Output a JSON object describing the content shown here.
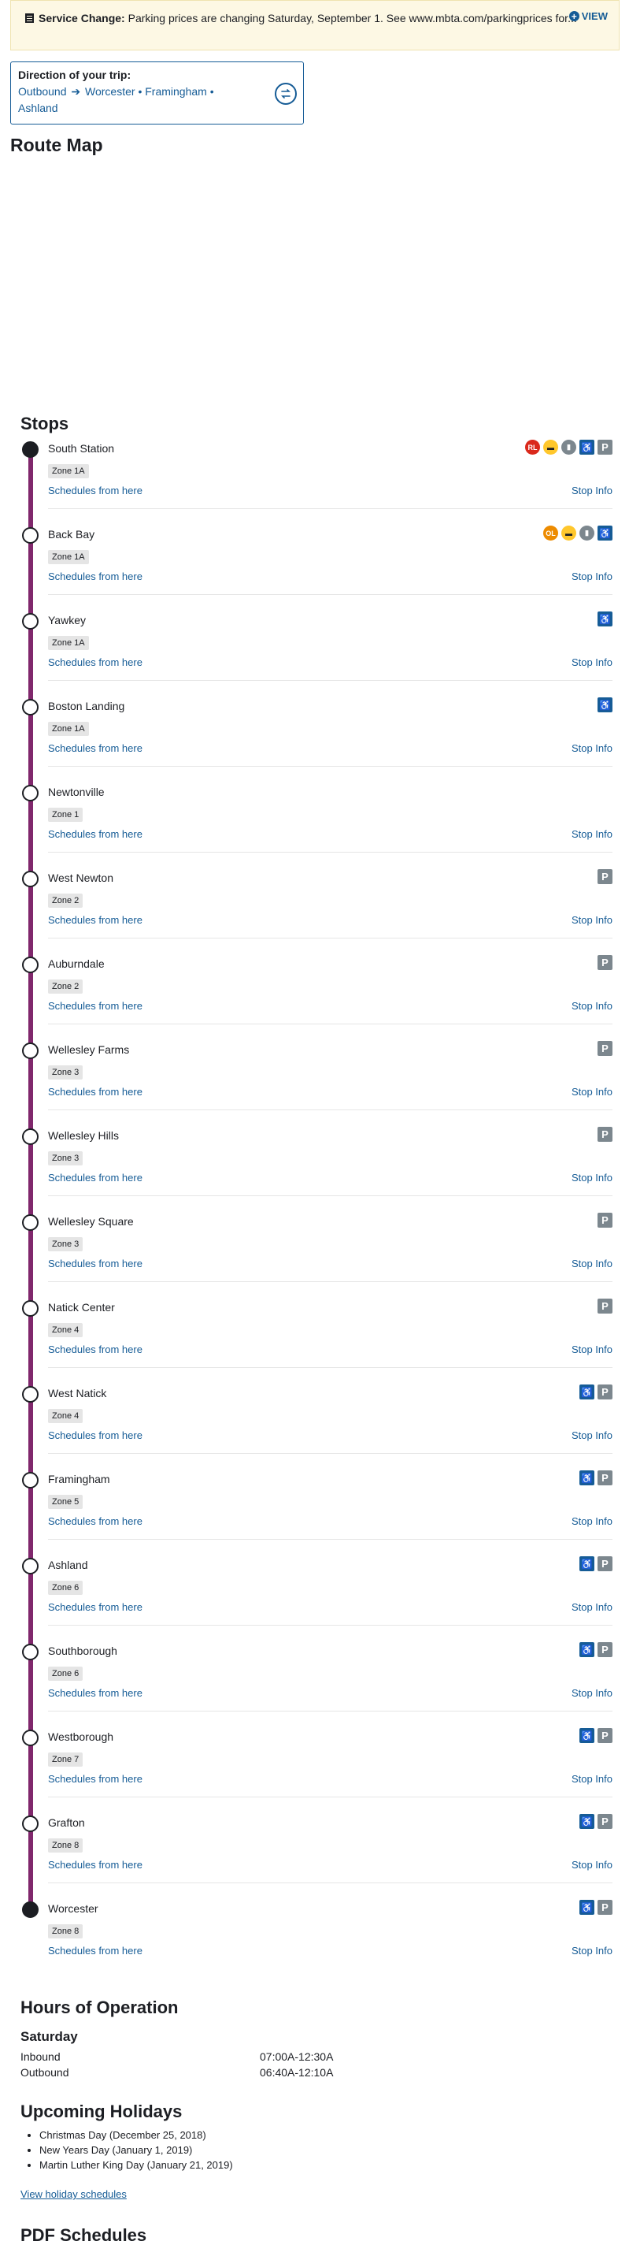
{
  "alert": {
    "label": "Service Change:",
    "message": "Parking prices are changing Saturday, September 1. See www.mbta.com/parkingprices for...",
    "view_label": "VIEW"
  },
  "direction": {
    "label": "Direction of your trip:",
    "from": "Outbound",
    "to": "Worcester • Framingham • Ashland"
  },
  "route_map_title": "Route Map",
  "stops_title": "Stops",
  "stops": [
    {
      "name": "South Station",
      "zone": "Zone 1A",
      "icons": [
        "RL",
        "bus",
        "SL",
        "accessible",
        "parking"
      ]
    },
    {
      "name": "Back Bay",
      "zone": "Zone 1A",
      "icons": [
        "OL",
        "bus",
        "SL",
        "accessible"
      ]
    },
    {
      "name": "Yawkey",
      "zone": "Zone 1A",
      "icons": [
        "accessible"
      ]
    },
    {
      "name": "Boston Landing",
      "zone": "Zone 1A",
      "icons": [
        "accessible"
      ]
    },
    {
      "name": "Newtonville",
      "zone": "Zone 1",
      "icons": []
    },
    {
      "name": "West Newton",
      "zone": "Zone 2",
      "icons": [
        "parking"
      ]
    },
    {
      "name": "Auburndale",
      "zone": "Zone 2",
      "icons": [
        "parking"
      ]
    },
    {
      "name": "Wellesley Farms",
      "zone": "Zone 3",
      "icons": [
        "parking"
      ]
    },
    {
      "name": "Wellesley Hills",
      "zone": "Zone 3",
      "icons": [
        "parking"
      ]
    },
    {
      "name": "Wellesley Square",
      "zone": "Zone 3",
      "icons": [
        "parking"
      ]
    },
    {
      "name": "Natick Center",
      "zone": "Zone 4",
      "icons": [
        "parking"
      ]
    },
    {
      "name": "West Natick",
      "zone": "Zone 4",
      "icons": [
        "accessible",
        "parking"
      ]
    },
    {
      "name": "Framingham",
      "zone": "Zone 5",
      "icons": [
        "accessible",
        "parking"
      ]
    },
    {
      "name": "Ashland",
      "zone": "Zone 6",
      "icons": [
        "accessible",
        "parking"
      ]
    },
    {
      "name": "Southborough",
      "zone": "Zone 6",
      "icons": [
        "accessible",
        "parking"
      ]
    },
    {
      "name": "Westborough",
      "zone": "Zone 7",
      "icons": [
        "accessible",
        "parking"
      ]
    },
    {
      "name": "Grafton",
      "zone": "Zone 8",
      "icons": [
        "accessible",
        "parking"
      ]
    },
    {
      "name": "Worcester",
      "zone": "Zone 8",
      "icons": [
        "accessible",
        "parking"
      ]
    }
  ],
  "stop_links": {
    "schedules": "Schedules from here",
    "info": "Stop Info"
  },
  "hours": {
    "title": "Hours of Operation",
    "day": "Saturday",
    "rows": [
      {
        "label": "Inbound",
        "value": "07:00A-12:30A"
      },
      {
        "label": "Outbound",
        "value": "06:40A-12:10A"
      }
    ]
  },
  "holidays": {
    "title": "Upcoming Holidays",
    "items": [
      "Christmas Day (December 25, 2018)",
      "New Years Day (January 1, 2019)",
      "Martin Luther King Day (January 21, 2019)"
    ],
    "link": "View holiday schedules"
  },
  "pdf_title": "PDF Schedules",
  "colors": {
    "route_line": "#80276c",
    "link": "#165c96",
    "alert_bg": "#fdf8e4"
  }
}
